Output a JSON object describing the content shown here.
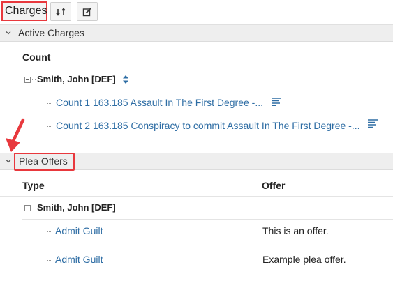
{
  "toolbar": {
    "title": "Charges",
    "swap_icon": "swap-icon",
    "edit_icon": "edit-icon"
  },
  "active_charges": {
    "section_label": "Active Charges",
    "column_header": "Count",
    "party": "Smith, John [DEF]",
    "counts": [
      {
        "label": "Count 1 163.185 Assault In The First Degree -..."
      },
      {
        "label": "Count 2 163.185 Conspiracy to commit Assault In The First Degree -..."
      }
    ]
  },
  "plea_offers": {
    "section_label": "Plea Offers",
    "column_type": "Type",
    "column_offer": "Offer",
    "party": "Smith, John [DEF]",
    "rows": [
      {
        "type": "Admit Guilt",
        "offer": "This is an offer."
      },
      {
        "type": "Admit Guilt",
        "offer": "Example plea offer."
      }
    ]
  },
  "colors": {
    "highlight": "#e8383d",
    "link": "#2e6da4",
    "section_bg": "#eeeeee",
    "sort_icon": "#2e6da4"
  }
}
